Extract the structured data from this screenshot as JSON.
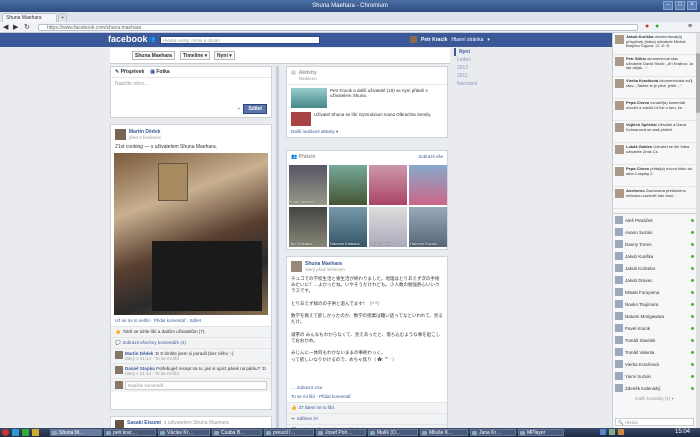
{
  "window": {
    "title": "Shuna Maehara - Chromium"
  },
  "tabs": [
    {
      "label": "Shuna Maehara"
    }
  ],
  "browser": {
    "url": "https://www.facebook.com/shuna.maehara"
  },
  "fb": {
    "logo": "facebook",
    "search_placeholder": "Hledat osoby, místa a obsah",
    "user_name": "Petr Kracik",
    "home_label": "Hlavní stránka"
  },
  "profile": {
    "name": "Shuna Maehara",
    "timeline_label": "Timeline ▾",
    "now_label": "Nyní ▾"
  },
  "composer": {
    "tab_status": "Příspěvek",
    "tab_photo": "Fotka",
    "placeholder": "Napište něco...",
    "submit": "Sdílet"
  },
  "post1": {
    "author": "Martin Dědek",
    "time": "před 8 hodinami",
    "text": "21st cooking — s uživatelem Shuna Maehara.",
    "actions": "Už se mi to nelíbí · Přidat komentář · Sdílet",
    "likes": "Tobě se tohle líbí a dalším uživatelům (7).",
    "view_comments": "Zobrazit všechny komentáře (4)",
    "comments": [
      {
        "author": "Martin Dědek",
        "text": ":D S tímhle jsem si poradil (bez něho ;-)",
        "time": "úterý v 21:14 · To se mi líbí"
      },
      {
        "author": "Daniel Stopka",
        "text": "Potřebuješ recept na to, jak si opíct párek na párku? :D",
        "time": "úterý v 21:14 · To se mi líbí"
      }
    ],
    "comment_placeholder": "Napište komentář..."
  },
  "post2": {
    "author": "Sasaki Etsumi",
    "text": "s uživatelem Shuna Maehara"
  },
  "activity": {
    "title": "Aktivity",
    "subtitle": "Nedávno",
    "item1": "Petr Kracik a další uživatelé (19) se nyní přátelí s uživatelem Shuna.",
    "item2": "Uživatel Shuna se líbí Gymnázium Ivana Olbrachta Semily.",
    "more": "Další nedávné aktivity ▾"
  },
  "friends": {
    "title": "Přátelé",
    "show_all": "Zobrazit vše",
    "list": [
      "Kouji Tanaka",
      "",
      "",
      "",
      "Jiro Hokatsu",
      "Nanami Kataoka",
      "Vinh Cheng",
      "Hanami Suzuki"
    ]
  },
  "years": [
    "Nyní",
    "Leden",
    "2012",
    "2011",
    "Narození"
  ],
  "post3": {
    "author": "Shuna Maehara",
    "time": "úterý před měsícem",
    "text": "チュコでの学校生活と寮生活が終わりました。地理はとりあえず次の手術みたいに？…よかったね。いやそうだけれども。少人数の勉強熱心いいクラスです。\n\nとりあえず緑のの子供と遊んでます！（^ ^）\n\n数学を教えて欲しかったのか、数学の授業は難い話ってなといわれて、見るだけ。\n\n滅茶の みんなもわからなくて、見えあったと、落ち込むような事を起こしておおかめ。\n\nみじんに一体何もわかないままの事終わっく。\nって欲しいなりかけるので、めちゃ焦り（ ✿´ ꒳ ` ）",
    "more": "… Zobrazit více",
    "like_action": "To se mi líbí · Přidat komentář",
    "likes": "37 lidem se to líbí.",
    "shares": "Sdíleno 2×",
    "view_comments": "Zobrazit všechny komentáře (10)"
  },
  "ticker": [
    {
      "name": "Jakub Kuriška",
      "text": "okomentoval(a) příspěvek (fotka) uživatele Michal Brejcha Čigova: ;D :D :D"
    },
    {
      "name": "Petr Stihlo",
      "text": "okomentoval stav uživatele David Straň: „Jiří Kratína: Ja tak nějak…“"
    },
    {
      "name": "Vierka Kracíková",
      "text": "okomentovala svůj stav: „Takhle to je plné, ještě…“"
    },
    {
      "name": "Pepa Chovo",
      "text": "označil(a) komentář úvodní a zaslal 14 lidí o tom, že…"
    },
    {
      "name": "Vojtěch Splichal",
      "text": "Uživatel a Dana Kolmanová se stali přáteli."
    },
    {
      "name": "Lukáš Gaiden",
      "text": "Uživatel se líbí fotka uživatele Zmik Cz."
    },
    {
      "name": "Pepa Chovo",
      "text": "přidal(a) novou fotku do alba Cosplay 2."
    },
    {
      "name": "Anchoreo",
      "text": "Zachorana předloženo nebudou zachvět tuto část…"
    }
  ],
  "chat": [
    {
      "name": "Aleš Petráček"
    },
    {
      "name": "Asano Suzuki"
    },
    {
      "name": "Danny Torres"
    },
    {
      "name": "Jakub Kuriška"
    },
    {
      "name": "Jakub Korbelar"
    },
    {
      "name": "Jakub Dravec"
    },
    {
      "name": "Misaki Furuyama"
    },
    {
      "name": "Naoko Tsujimura"
    },
    {
      "name": "Natumi Morigawara"
    },
    {
      "name": "Pavel Kracik"
    },
    {
      "name": "Tomáš Slavítek"
    },
    {
      "name": "Tomáš Valenta"
    },
    {
      "name": "Vierka Kracíková"
    },
    {
      "name": "Yuimi Suzuki"
    },
    {
      "name": "Zdeněk Kaleniský"
    }
  ],
  "chat_more": "Další kontakty (2) ▾",
  "chat_search": "Hledat",
  "taskbar": [
    {
      "label": "Shuna M…"
    },
    {
      "label": "petr.krac…"
    },
    {
      "label": "Václav Kr…"
    },
    {
      "label": "Csaba B…"
    },
    {
      "label": "preucil I…"
    },
    {
      "label": "Josef Poh…"
    },
    {
      "label": "Malík (O…"
    },
    {
      "label": "Miluše K…"
    },
    {
      "label": "Jana Kr…"
    },
    {
      "label": "MPlayer"
    }
  ],
  "clock": "15:04",
  "colors": {
    "fb_blue": "#3b5998",
    "online": "#42b72a"
  }
}
